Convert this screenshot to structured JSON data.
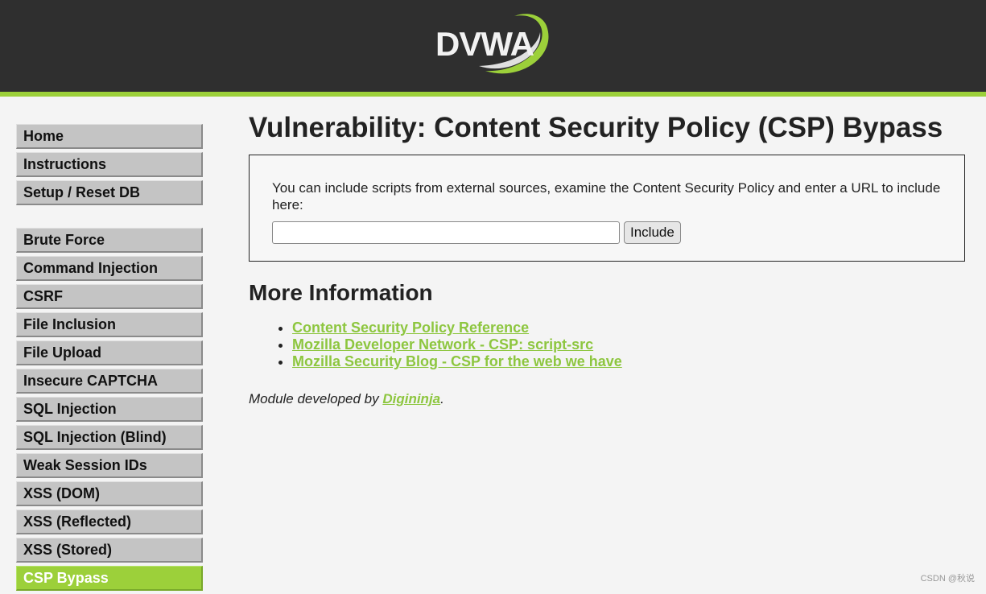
{
  "logo": {
    "text": "DVWA",
    "swoosh_color": "#9cd03a"
  },
  "colors": {
    "header_bg": "#2f2f2f",
    "accent": "#9cd03a",
    "link": "#8dc63f"
  },
  "sidebar": {
    "top_items": [
      {
        "label": "Home"
      },
      {
        "label": "Instructions"
      },
      {
        "label": "Setup / Reset DB"
      }
    ],
    "vuln_items": [
      {
        "label": "Brute Force"
      },
      {
        "label": "Command Injection"
      },
      {
        "label": "CSRF"
      },
      {
        "label": "File Inclusion"
      },
      {
        "label": "File Upload"
      },
      {
        "label": "Insecure CAPTCHA"
      },
      {
        "label": "SQL Injection"
      },
      {
        "label": "SQL Injection (Blind)"
      },
      {
        "label": "Weak Session IDs"
      },
      {
        "label": "XSS (DOM)"
      },
      {
        "label": "XSS (Reflected)"
      },
      {
        "label": "XSS (Stored)"
      },
      {
        "label": "CSP Bypass",
        "selected": true
      }
    ]
  },
  "main": {
    "title": "Vulnerability: Content Security Policy (CSP) Bypass",
    "description": "You can include scripts from external sources, examine the Content Security Policy and enter a URL to include here:",
    "url_input_value": "",
    "include_button": "Include",
    "more_info_title": "More Information",
    "links": [
      "Content Security Policy Reference",
      "Mozilla Developer Network - CSP: script-src",
      "Mozilla Security Blog - CSP for the web we have"
    ],
    "credit_prefix": "Module developed by ",
    "credit_author": "Digininja",
    "credit_suffix": "."
  },
  "watermark": "CSDN @秋说"
}
